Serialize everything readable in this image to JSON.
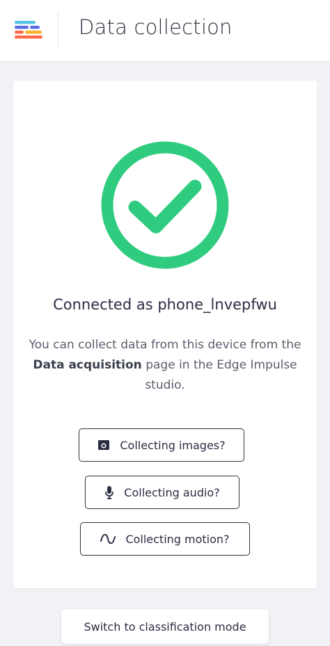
{
  "header": {
    "title": "Data collection",
    "logo_icon": "edge-impulse-logo",
    "logo_colors": [
      "#56c3e6",
      "#5b6ce0",
      "#ff6b4a",
      "#f6b32a",
      "#34d17a"
    ]
  },
  "status": {
    "icon": "check-circle-icon",
    "color": "#2fcc7f",
    "heading": "Connected as phone_lnvepfwu",
    "description_before": "You can collect data from this device from the ",
    "description_bold": "Data acquisition",
    "description_after": " page in the Edge Impulse studio."
  },
  "actions": {
    "images": {
      "label": "Collecting images?",
      "icon": "camera-icon"
    },
    "audio": {
      "label": "Collecting audio?",
      "icon": "microphone-icon"
    },
    "motion": {
      "label": "Collecting motion?",
      "icon": "wave-icon"
    }
  },
  "footer": {
    "switch_label": "Switch to classification mode"
  }
}
